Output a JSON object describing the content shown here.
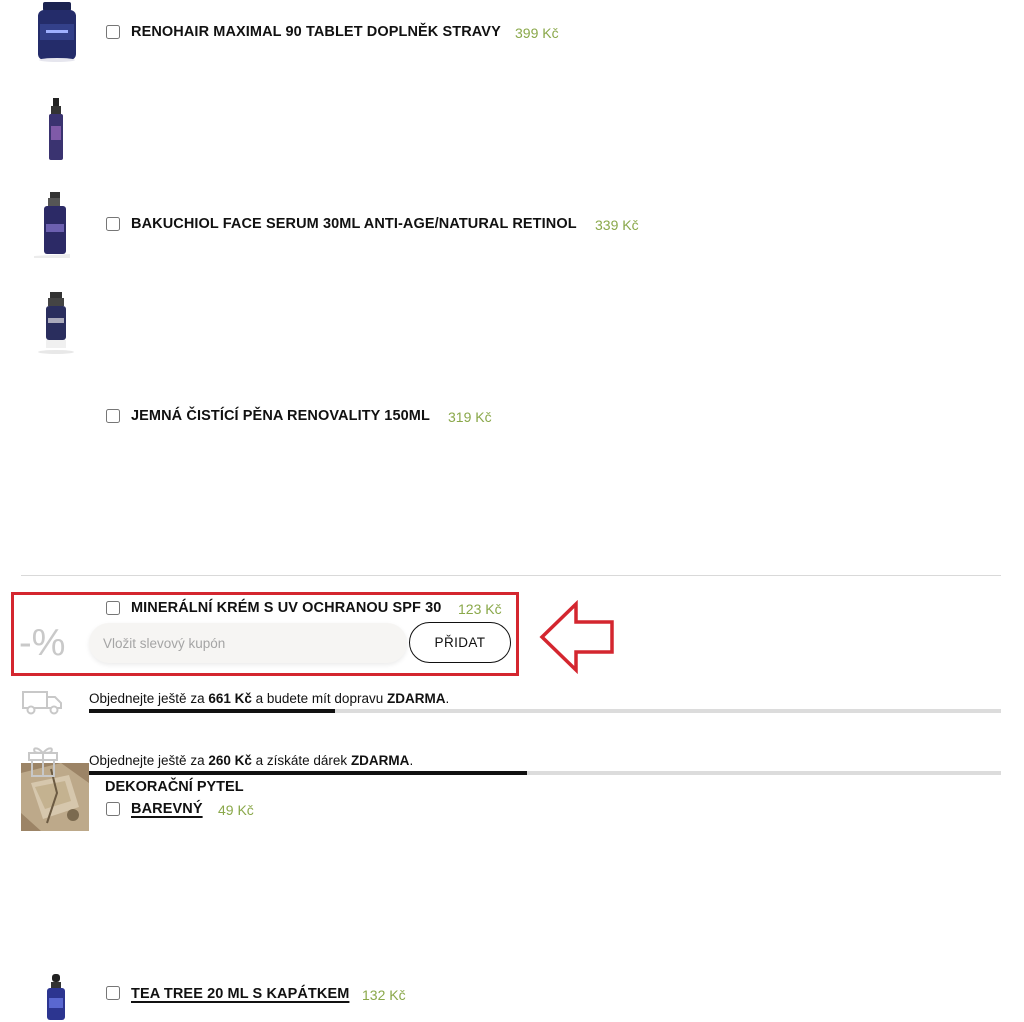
{
  "products": [
    {
      "name": "RENOHAIR MAXIMAL 90 TABLET DOPLNĚK STRAVY",
      "price": "399 Kč",
      "icon": "supplement-jar"
    },
    {
      "name": "BAKUCHIOL FACE SERUM 30ML ANTI-AGE/NATURAL RETINOL",
      "price": "339 Kč",
      "icon": "serum-bottle"
    },
    {
      "name": "JEMNÁ ČISTÍCÍ PĚNA RENOVALITY 150ML",
      "price": "319 Kč",
      "icon": "foam-bottle"
    },
    {
      "name": "MINERÁLNÍ KRÉM S UV OCHRANOU SPF 30",
      "price": "123 Kč",
      "icon": "cream-pump-bottle"
    }
  ],
  "decor_bag": {
    "title": "DEKORAČNÍ PYTEL",
    "variant": "BAREVNÝ",
    "price": "49 Kč",
    "icon": "linen-bag-photo"
  },
  "tea_tree": {
    "name": "TEA TREE 20 ML S KAPÁTKEM",
    "price": "132 Kč",
    "icon": "dropper-bottle"
  },
  "coupon": {
    "icon_text": "-%",
    "placeholder": "Vložit slevový kupón",
    "value": "",
    "button_label": "PŘIDAT"
  },
  "shipping": {
    "icon": "truck-icon",
    "text_before": "Objednejte ještě za ",
    "amount": "661 Kč",
    "text_middle": " a budete mít dopravu ",
    "emphasis": "ZDARMA",
    "text_after": ".",
    "progress": 0.27
  },
  "gift": {
    "icon": "gift-icon",
    "text_before": "Objednejte ještě za ",
    "amount": "260 Kč",
    "text_middle": " a získáte dárek ",
    "emphasis": "ZDARMA",
    "text_after": ".",
    "progress": 0.48
  },
  "colors": {
    "price": "#8aa84a",
    "highlight": "#d4262f",
    "progress_fill": "#111111",
    "progress_track": "#dcdcdc"
  }
}
